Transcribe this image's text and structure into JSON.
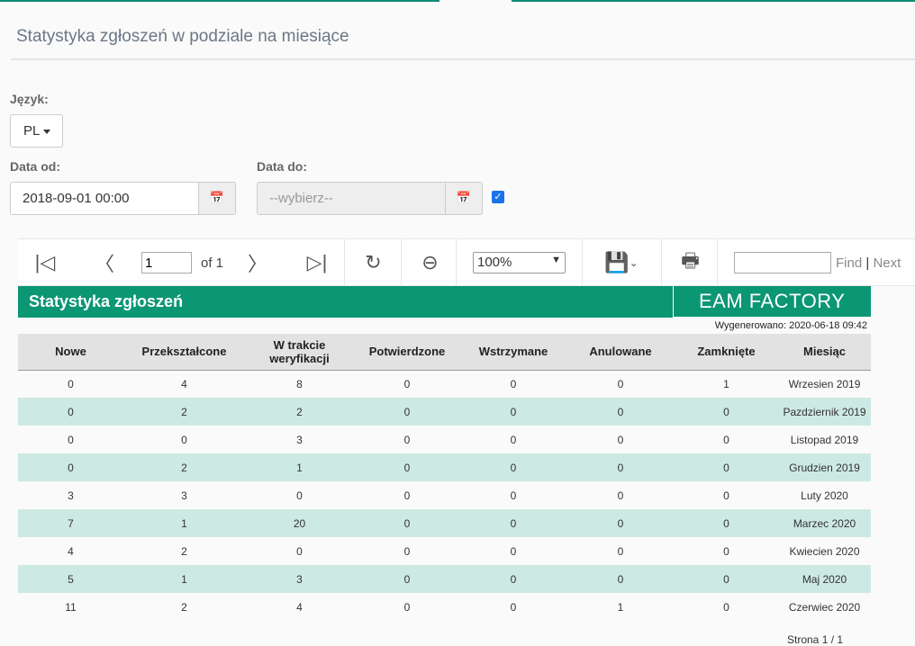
{
  "page_title": "Statystyka zgłoszeń w podziale na miesiące",
  "language": {
    "label": "Język:",
    "value": "PL"
  },
  "date_from": {
    "label": "Data od:",
    "value": "2018-09-01 00:00"
  },
  "date_to": {
    "label": "Data do:",
    "placeholder": "--wybierz--",
    "checkbox_checked": true
  },
  "toolbar": {
    "page": "1",
    "of": "of 1",
    "zoom": "100%",
    "find": "Find",
    "separator": "|",
    "next": "Next"
  },
  "report": {
    "title": "Statystyka zgłoszeń",
    "logo": "EAM FACTORY",
    "generated": "Wygenerowano: 2020-06-18 09:42",
    "footer": "Strona 1 / 1",
    "headers": [
      "Nowe",
      "Przekształcone",
      "W trakcie weryfikacji",
      "Potwierdzone",
      "Wstrzymane",
      "Anulowane",
      "Zamknięte",
      "Miesiąc"
    ],
    "rows": [
      [
        "0",
        "4",
        "8",
        "0",
        "0",
        "0",
        "1",
        "Wrzesien 2019"
      ],
      [
        "0",
        "2",
        "2",
        "0",
        "0",
        "0",
        "0",
        "Pazdziernik 2019"
      ],
      [
        "0",
        "0",
        "3",
        "0",
        "0",
        "0",
        "0",
        "Listopad 2019"
      ],
      [
        "0",
        "2",
        "1",
        "0",
        "0",
        "0",
        "0",
        "Grudzien 2019"
      ],
      [
        "3",
        "3",
        "0",
        "0",
        "0",
        "0",
        "0",
        "Luty 2020"
      ],
      [
        "7",
        "1",
        "20",
        "0",
        "0",
        "0",
        "0",
        "Marzec 2020"
      ],
      [
        "4",
        "2",
        "0",
        "0",
        "0",
        "0",
        "0",
        "Kwiecien 2020"
      ],
      [
        "5",
        "1",
        "3",
        "0",
        "0",
        "0",
        "0",
        "Maj 2020"
      ],
      [
        "11",
        "2",
        "4",
        "0",
        "0",
        "1",
        "0",
        "Czerwiec 2020"
      ]
    ]
  },
  "colors": {
    "brand": "#0b9674",
    "stripe": "#cde9e3"
  }
}
